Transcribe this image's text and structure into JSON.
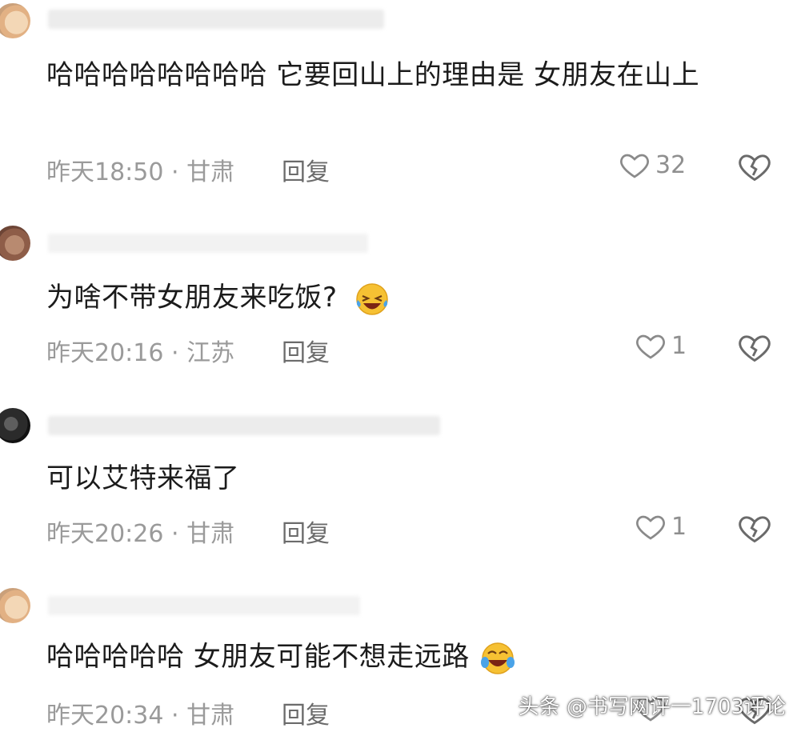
{
  "comments": [
    {
      "text": "哈哈哈哈哈哈哈哈  它要回山上的理由是 女朋友在山上",
      "meta": "昨天18:50 · 甘肃",
      "reply": "回复",
      "likes": "32"
    },
    {
      "text": "为啥不带女朋友来吃饭?",
      "emoji": "grinning-squinting-tears-emoji",
      "meta": "昨天20:16 · 江苏",
      "reply": "回复",
      "likes": "1"
    },
    {
      "text": "可以艾特来福了",
      "meta": "昨天20:26 · 甘肃",
      "reply": "回复",
      "likes": "1"
    },
    {
      "text": "哈哈哈哈哈 女朋友可能不想走远路",
      "emoji": "face-with-tears-of-joy-emoji",
      "meta": "昨天20:34 · 甘肃",
      "reply": "回复",
      "likes": ""
    }
  ],
  "watermark": "头条 @书写网评一1703评论",
  "icons": {
    "like": "heart-outline-icon",
    "dislike": "broken-heart-icon"
  }
}
